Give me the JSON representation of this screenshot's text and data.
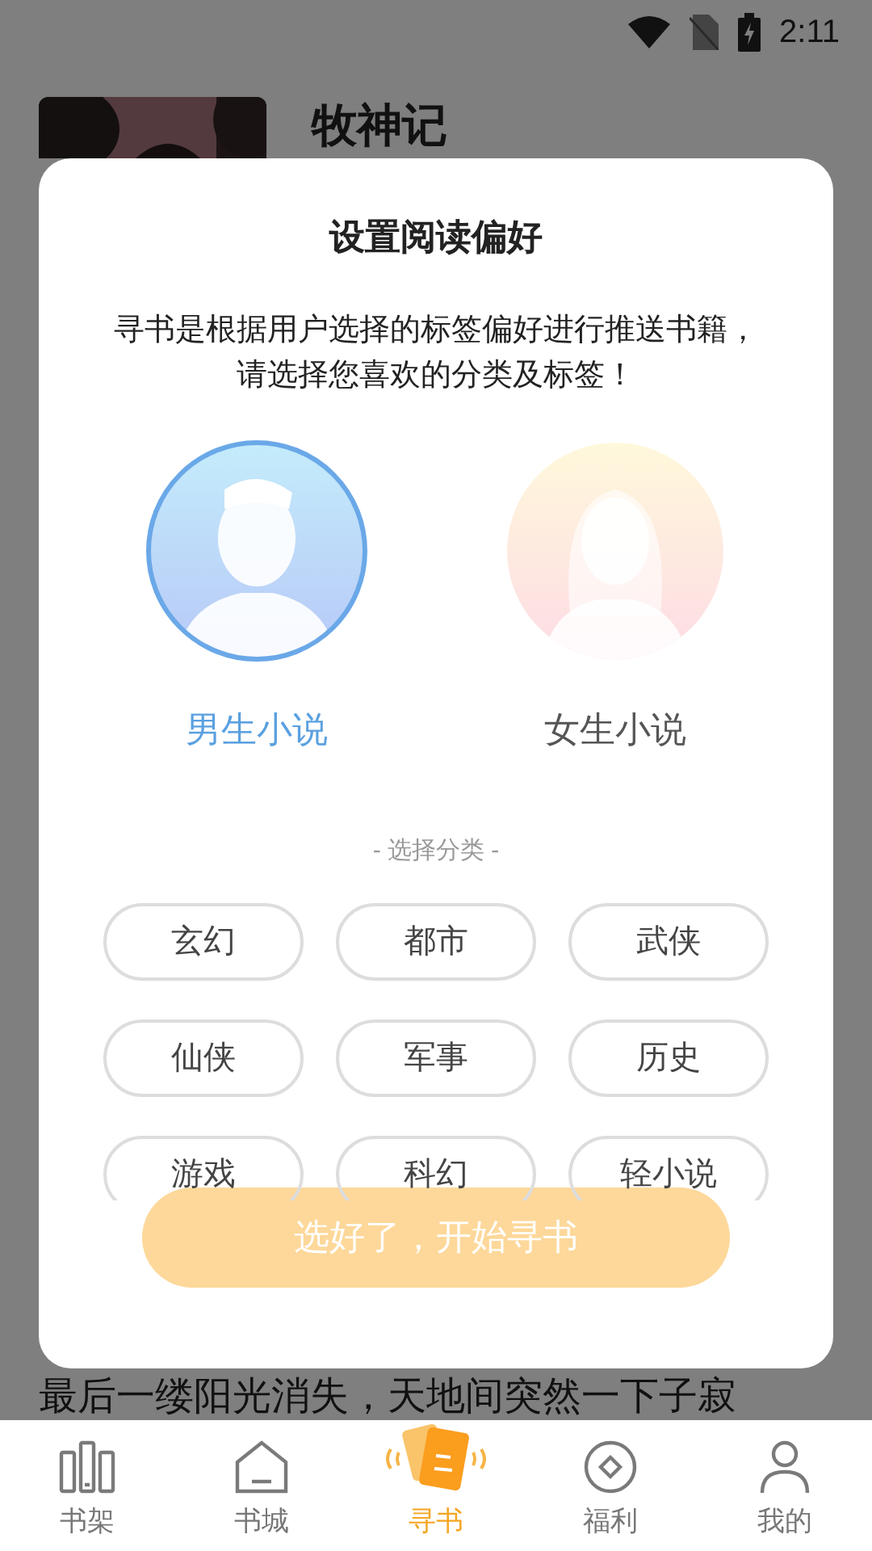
{
  "status_bar": {
    "time": "2:11"
  },
  "background": {
    "book_title": "牧神记",
    "text_line": "最后一缕阳光消失，天地间突然一下子寂"
  },
  "dialog": {
    "title": "设置阅读偏好",
    "description": "寻书是根据用户选择的标签偏好进行推送书籍，请选择您喜欢的分类及标签！",
    "genders": [
      {
        "kind": "male",
        "label": "男生小说",
        "selected": true
      },
      {
        "kind": "female",
        "label": "女生小说",
        "selected": false
      }
    ],
    "section_label": "- 选择分类 -",
    "tags": [
      {
        "label": "玄幻",
        "selected": false
      },
      {
        "label": "都市",
        "selected": false
      },
      {
        "label": "武侠",
        "selected": false
      },
      {
        "label": "仙侠",
        "selected": false
      },
      {
        "label": "军事",
        "selected": false
      },
      {
        "label": "历史",
        "selected": false
      },
      {
        "label": "游戏",
        "selected": false
      },
      {
        "label": "科幻",
        "selected": false
      },
      {
        "label": "轻小说",
        "selected": false
      }
    ],
    "confirm_button": {
      "label": "选好了，开始寻书",
      "disabled": true
    }
  },
  "bottom_nav": [
    {
      "kind": "shelf",
      "label": "书架",
      "selected": false
    },
    {
      "kind": "store",
      "label": "书城",
      "selected": false
    },
    {
      "kind": "find",
      "label": "寻书",
      "selected": true
    },
    {
      "kind": "welfare",
      "label": "福利",
      "selected": false
    },
    {
      "kind": "me",
      "label": "我的",
      "selected": false
    }
  ]
}
